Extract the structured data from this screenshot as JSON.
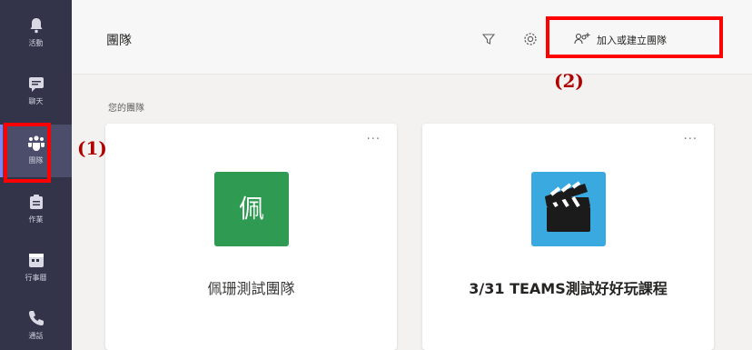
{
  "rail": {
    "items": [
      {
        "icon": "bell-icon",
        "label": "活動"
      },
      {
        "icon": "chat-icon",
        "label": "聊天"
      },
      {
        "icon": "teams-icon",
        "label": "團隊"
      },
      {
        "icon": "assignments-icon",
        "label": "作業"
      },
      {
        "icon": "calendar-icon",
        "label": "行事曆"
      },
      {
        "icon": "phone-icon",
        "label": "通話"
      }
    ],
    "active_index": 2
  },
  "header": {
    "title": "團隊",
    "join_label": "加入或建立團隊"
  },
  "section_label": "您的團隊",
  "teams": [
    {
      "avatar_text": "佩",
      "name": "佩珊測試團隊",
      "avatar_color": "#2f9a52"
    },
    {
      "avatar_icon": "clapperboard-icon",
      "name": "3/31 TEAMS測試好好玩課程",
      "avatar_color": "#3aa9df"
    }
  ],
  "card_menu": "...",
  "annotations": {
    "a1": "(1)",
    "a2": "(2)"
  },
  "colors": {
    "rail_bg": "#33344a",
    "highlight": "#ff0000",
    "annotation_text": "#b00000"
  }
}
